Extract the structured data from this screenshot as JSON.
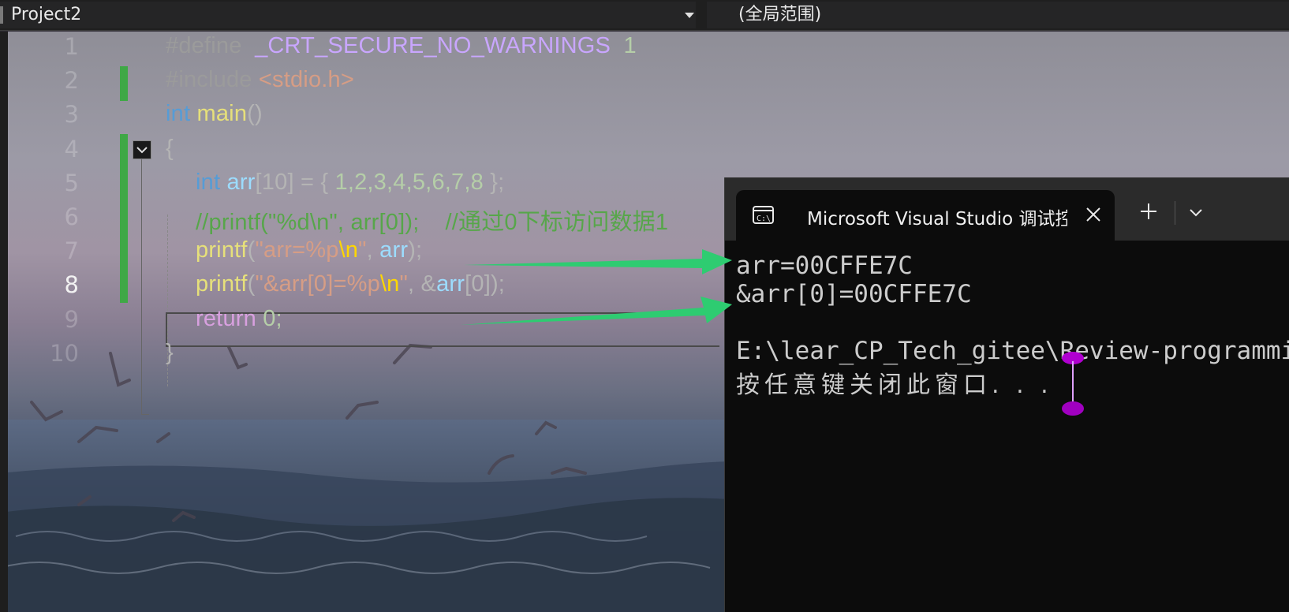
{
  "navbar": {
    "project": "Project2",
    "scope": "(全局范围)"
  },
  "editor": {
    "line_numbers": [
      "1",
      "2",
      "3",
      "4",
      "5",
      "6",
      "7",
      "8",
      "9",
      "10"
    ],
    "current_line": "8",
    "code_lines": [
      [
        {
          "t": "#define ",
          "c": "#9b9b9b"
        },
        {
          "t": " _CRT_SECURE_NO_WARNINGS",
          "c": "#c9a6ff"
        },
        {
          "t": "  1",
          "c": "#b5cea8"
        }
      ],
      [
        {
          "t": "#include ",
          "c": "#9b9b9b"
        },
        {
          "t": "<stdio.h>",
          "c": "#d69d85"
        }
      ],
      [
        {
          "t": "int",
          "c": "#569cd6"
        },
        {
          "t": " main",
          "c": "#e6e07a"
        },
        {
          "t": "()",
          "c": "#b4b4b4"
        }
      ],
      [
        {
          "t": "{",
          "c": "#b4b4b4"
        }
      ],
      [
        {
          "t": "int",
          "c": "#569cd6"
        },
        {
          "t": " arr",
          "c": "#9cdcfe"
        },
        {
          "t": "[10] = { ",
          "c": "#b4b4b4"
        },
        {
          "t": "1,2,3,4,5,6,7,8",
          "c": "#b5cea8"
        },
        {
          "t": " };",
          "c": "#b4b4b4"
        }
      ],
      [
        {
          "t": "//printf(\"%d\\n\", arr[0]);    //通过0下标访问数据1",
          "c": "#57a64a"
        }
      ],
      [
        {
          "t": "printf",
          "c": "#e6e07a"
        },
        {
          "t": "(",
          "c": "#b4b4b4"
        },
        {
          "t": "\"arr=%p",
          "c": "#d69d85"
        },
        {
          "t": "\\n",
          "c": "#ffd700"
        },
        {
          "t": "\"",
          "c": "#d69d85"
        },
        {
          "t": ", ",
          "c": "#b4b4b4"
        },
        {
          "t": "arr",
          "c": "#9cdcfe"
        },
        {
          "t": ");",
          "c": "#b4b4b4"
        }
      ],
      [
        {
          "t": "printf",
          "c": "#e6e07a"
        },
        {
          "t": "(",
          "c": "#b4b4b4"
        },
        {
          "t": "\"&arr[0]=%p",
          "c": "#d69d85"
        },
        {
          "t": "\\n",
          "c": "#ffd700"
        },
        {
          "t": "\"",
          "c": "#d69d85"
        },
        {
          "t": ", &",
          "c": "#b4b4b4"
        },
        {
          "t": "arr",
          "c": "#9cdcfe"
        },
        {
          "t": "[0]);",
          "c": "#b4b4b4"
        }
      ],
      [
        {
          "t": "return",
          "c": "#d8a0df"
        },
        {
          "t": " 0;",
          "c": "#b5cea8"
        }
      ],
      [
        {
          "t": "}",
          "c": "#b4b4b4"
        }
      ]
    ]
  },
  "terminal": {
    "tab_title": "Microsoft Visual Studio 调试控制台",
    "output_lines": [
      "arr=00CFFE7C",
      "&arr[0]=00CFFE7C",
      "",
      "E:\\lear_CP_Tech_gitee\\Review-programming",
      "按任意键关闭此窗口. . ."
    ]
  },
  "icons": {
    "fold": "fold-collapse-icon",
    "terminal": "terminal-console-icon",
    "close": "close-icon",
    "new_tab": "plus-icon",
    "tab_menu": "chevron-down-icon",
    "dropdown": "caret-down-icon"
  },
  "colors": {
    "change_bar": "#3fa846",
    "arrow": "#2ecc71",
    "cursor_marker": "#b000d0"
  }
}
